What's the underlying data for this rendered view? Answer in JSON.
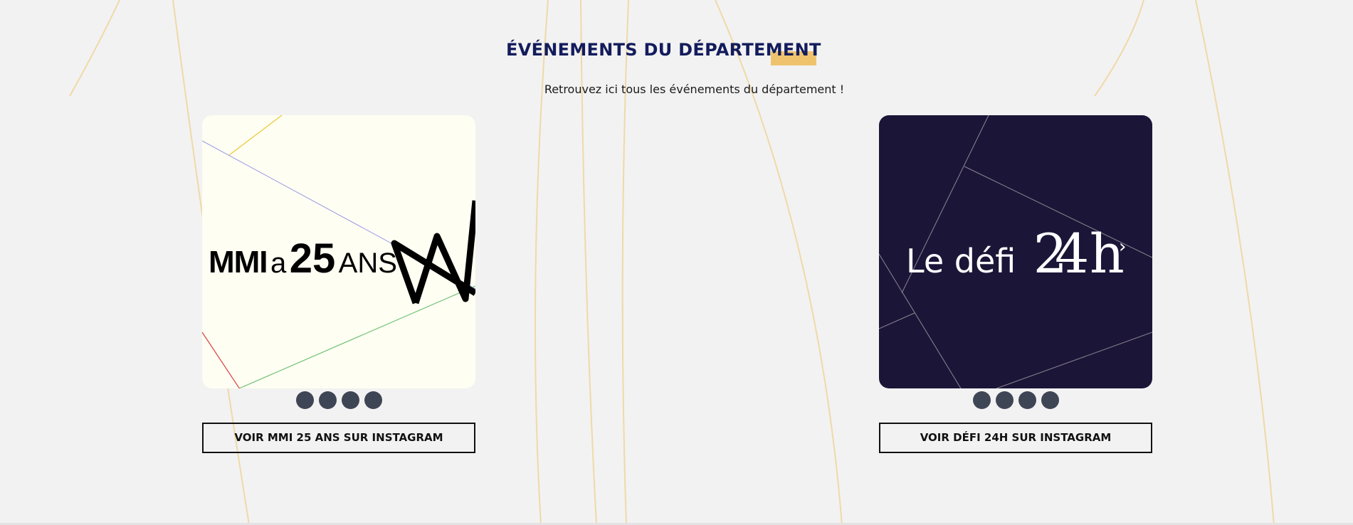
{
  "section": {
    "title": "ÉVÉNEMENTS DU DÉPARTEMENT",
    "subtitle": "Retrouvez ici tous les événements du département !",
    "accent_color": "#efc36e",
    "title_color": "#131c5c"
  },
  "carousels": [
    {
      "slide": {
        "text_prefix": "MMI",
        "text_a": "a",
        "text_num": "25",
        "text_suffix": "ANS",
        "background": "#fefef3"
      },
      "dots_count": 4,
      "button_label": "VOIR MMI 25 ANS SUR INSTAGRAM"
    },
    {
      "slide": {
        "text_main": "Le défi",
        "text_num": "24",
        "text_h": "h",
        "next_arrow": "›",
        "background": "#1b1638"
      },
      "dots_count": 4,
      "button_label": "VOIR DÉFI 24H SUR INSTAGRAM"
    }
  ],
  "icons": {
    "next": "chevron-right-icon",
    "dot": "carousel-dot-icon"
  }
}
